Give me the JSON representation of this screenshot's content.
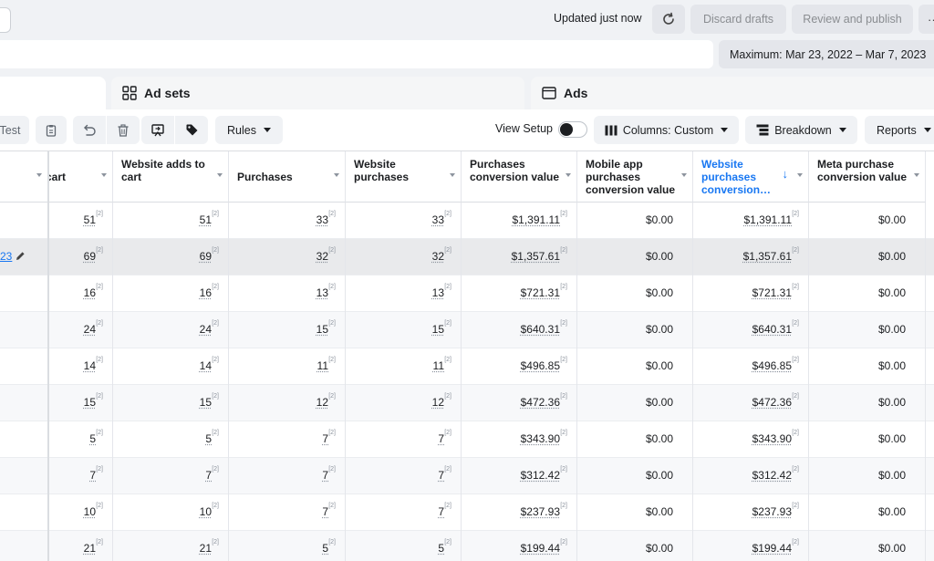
{
  "topbar": {
    "updated_text": "Updated just now",
    "discard_label": "Discard drafts",
    "review_label": "Review and publish",
    "more_label": "··"
  },
  "date_range": {
    "label": "Maximum: Mar 23, 2022 – Mar 7, 2023"
  },
  "tabs": {
    "ad_sets": "Ad sets",
    "ads": "Ads"
  },
  "toolbar": {
    "test_label": "Test",
    "rules_label": "Rules",
    "view_setup_label": "View Setup",
    "columns_label": "Columns: Custom",
    "breakdown_label": "Breakdown",
    "reports_label": "Reports"
  },
  "columns": [
    "cart",
    "Website adds to cart",
    "Purchases",
    "Website purchases",
    "Purchases conversion value",
    "Mobile app purchases conversion value",
    "Website purchases conversion…",
    "Meta purchase conversion value"
  ],
  "footnote_marker": "[2]",
  "rows": [
    {
      "name_fragment": "",
      "cells": [
        "51",
        "51",
        "33",
        "33",
        "$1,391.11",
        "$0.00",
        "$1,391.11",
        "$0.00"
      ]
    },
    {
      "name_fragment": "23",
      "cells": [
        "69",
        "69",
        "32",
        "32",
        "$1,357.61",
        "$0.00",
        "$1,357.61",
        "$0.00"
      ]
    },
    {
      "name_fragment": "",
      "cells": [
        "16",
        "16",
        "13",
        "13",
        "$721.31",
        "$0.00",
        "$721.31",
        "$0.00"
      ]
    },
    {
      "name_fragment": "",
      "cells": [
        "24",
        "24",
        "15",
        "15",
        "$640.31",
        "$0.00",
        "$640.31",
        "$0.00"
      ]
    },
    {
      "name_fragment": "",
      "cells": [
        "14",
        "14",
        "11",
        "11",
        "$496.85",
        "$0.00",
        "$496.85",
        "$0.00"
      ]
    },
    {
      "name_fragment": "",
      "cells": [
        "15",
        "15",
        "12",
        "12",
        "$472.36",
        "$0.00",
        "$472.36",
        "$0.00"
      ]
    },
    {
      "name_fragment": "",
      "cells": [
        "5",
        "5",
        "7",
        "7",
        "$343.90",
        "$0.00",
        "$343.90",
        "$0.00"
      ]
    },
    {
      "name_fragment": "",
      "cells": [
        "7",
        "7",
        "7",
        "7",
        "$312.42",
        "$0.00",
        "$312.42",
        "$0.00"
      ]
    },
    {
      "name_fragment": "",
      "cells": [
        "10",
        "10",
        "7",
        "7",
        "$237.93",
        "$0.00",
        "$237.93",
        "$0.00"
      ]
    },
    {
      "name_fragment": "",
      "cells": [
        "21",
        "21",
        "5",
        "5",
        "$199.44",
        "$0.00",
        "$199.44",
        "$0.00"
      ]
    }
  ],
  "colors": {
    "accent": "#1877f2",
    "button_bg": "#e4e6eb",
    "page_bg": "#f0f2f5"
  }
}
